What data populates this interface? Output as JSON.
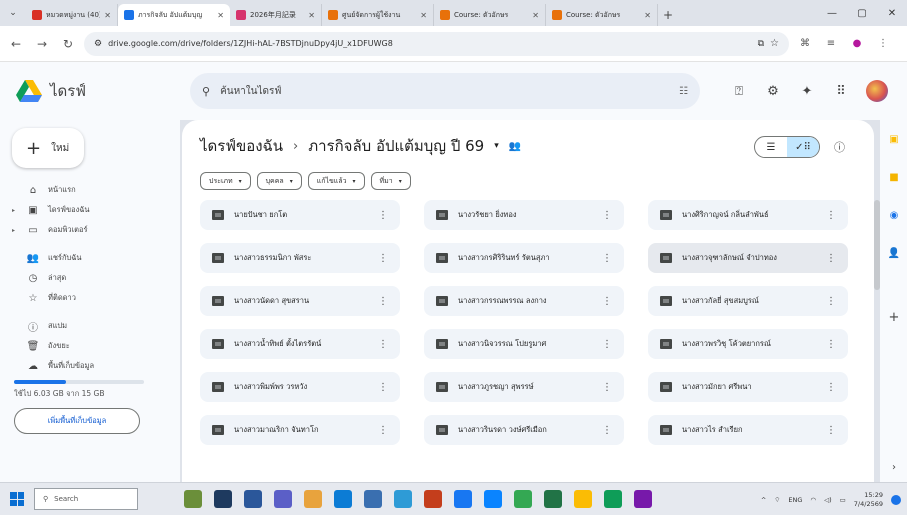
{
  "browser": {
    "tabs": [
      {
        "title": "หมวดหมู่งาน (40)",
        "favicon_color": "#d93025",
        "active": false
      },
      {
        "title": "ภารกิจลับ อัปแต้มบุญ",
        "favicon_color": "#1a73e8",
        "active": true
      },
      {
        "title": "2026年月記录",
        "favicon_color": "#d6336c",
        "active": false
      },
      {
        "title": "ศูนย์จัดการผู้ใช้งาน",
        "favicon_color": "#e8710a",
        "active": false
      },
      {
        "title": "Course: ตัวอักษร",
        "favicon_color": "#e8710a",
        "active": false
      },
      {
        "title": "Course: ตัวอักษร",
        "favicon_color": "#e8710a",
        "active": false
      }
    ],
    "url": "drive.google.com/drive/folders/1ZJHi-hAL-7BSTDjnuDpy4jU_x1DFUWG8"
  },
  "drive": {
    "app_name": "ไดรฟ์",
    "search_placeholder": "ค้นหาในไดรฟ์",
    "new_label": "ใหม่",
    "sidebar": [
      {
        "label": "หน้าแรก",
        "icon": "home-icon",
        "glyph": "⌂",
        "caret": false
      },
      {
        "label": "ไดรฟ์ของฉัน",
        "icon": "my-drive-icon",
        "glyph": "▣",
        "caret": true
      },
      {
        "label": "คอมพิวเตอร์",
        "icon": "computers-icon",
        "glyph": "▭",
        "caret": true
      },
      {
        "label": "แชร์กับฉัน",
        "icon": "shared-icon",
        "glyph": "👥",
        "caret": false
      },
      {
        "label": "ล่าสุด",
        "icon": "recent-icon",
        "glyph": "◷",
        "caret": false
      },
      {
        "label": "ที่ติดดาว",
        "icon": "star-icon",
        "glyph": "☆",
        "caret": false
      },
      {
        "label": "สแปม",
        "icon": "spam-icon",
        "glyph": "ⓘ",
        "caret": false
      },
      {
        "label": "ถังขยะ",
        "icon": "trash-icon",
        "glyph": "🗑",
        "caret": false
      },
      {
        "label": "พื้นที่เก็บข้อมูล",
        "icon": "cloud-icon",
        "glyph": "☁",
        "caret": false
      }
    ],
    "storage": {
      "text": "ใช้ไป 6.03 GB จาก 15 GB",
      "used_fraction": 0.4,
      "button": "เพิ่มพื้นที่เก็บข้อมูล"
    },
    "breadcrumb": {
      "root": "ไดรฟ์ของฉัน",
      "current": "ภารกิจลับ อัปแต้มบุญ ปี 69"
    },
    "filters": [
      "ประเภท",
      "บุคคล",
      "แก้ไขแล้ว",
      "ที่มา"
    ],
    "folders": [
      "นายปันชา ยกโต",
      "นางวรัชยา ยิ่งทอง",
      "นางศิริกาญจน์ กลิ่นลำพันธ์",
      "นางสาวธรรมนิกา พัสระ",
      "นางสาวกรศิริรินทร์ รัตนสุภา",
      "นางสาวจุฑาลักษณ์ จำปาทอง",
      "นางสาวนัดดา สุขสราน",
      "นางสาวกรรณพรรณ ลงกาง",
      "นางสาวกัลยี่ สุขสมบูรณ์",
      "นางสาวน้ำทิพย์ ตั้งไตรรัตน์",
      "นางสาวนิจวรรณ โปยรูมาศ",
      "นางสาวพรวิชุ โค้วตยากรณ์",
      "นางสาวพิมพ์พร วรหวัง",
      "นางสาวภูรชญา สุพรรษ์",
      "นางสาวมักยา ศรีพนา",
      "นางสาวมาณริกา จันทาโก",
      "นางสาวรินรดา วงษ์ศรีเมือก",
      "นางสาวไร สำเรียก"
    ],
    "selected_folder": 5
  },
  "taskbar": {
    "search_placeholder": "Search",
    "apps": [
      {
        "name": "widget-app-icon",
        "color": "#6b8f3a"
      },
      {
        "name": "terminal-app-icon",
        "color": "#1e3a5f"
      },
      {
        "name": "word-app-icon",
        "color": "#2b579a"
      },
      {
        "name": "chat-app-icon",
        "color": "#5b5fc7"
      },
      {
        "name": "files-app-icon",
        "color": "#e8a33d"
      },
      {
        "name": "edge-app-icon",
        "color": "#0c7cd5"
      },
      {
        "name": "store-app-icon",
        "color": "#3a6fb0"
      },
      {
        "name": "gallery-app-icon",
        "color": "#2e9bd6"
      },
      {
        "name": "powerpoint-app-icon",
        "color": "#c43e1c"
      },
      {
        "name": "facebook-app-icon",
        "color": "#1877f2"
      },
      {
        "name": "messenger-app-icon",
        "color": "#0a84ff"
      },
      {
        "name": "chrome-app-icon",
        "color": "#34a853"
      },
      {
        "name": "excel-app-icon",
        "color": "#217346"
      },
      {
        "name": "chrome-profile-app-icon",
        "color": "#fbbc04"
      },
      {
        "name": "greenapp-app-icon",
        "color": "#0f9d58"
      },
      {
        "name": "onenote-app-icon",
        "color": "#7719aa"
      }
    ],
    "lang": "ENG",
    "time": "15:29",
    "date": "7/4/2569"
  }
}
